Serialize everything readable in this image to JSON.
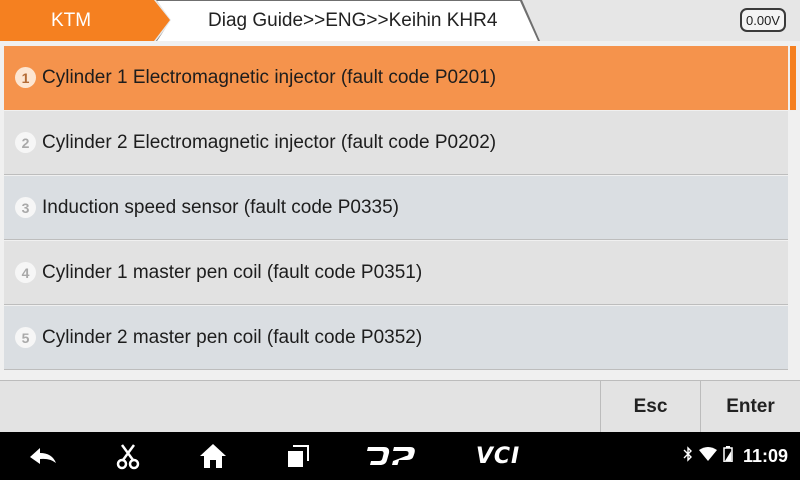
{
  "header": {
    "brand": "KTM",
    "breadcrumb": "Diag Guide>>ENG>>Keihin KHR4",
    "voltage": "0.00V"
  },
  "list": {
    "items": [
      {
        "number": "1",
        "label": "Cylinder 1 Electromagnetic injector (fault code P0201)",
        "selected": true
      },
      {
        "number": "2",
        "label": "Cylinder 2 Electromagnetic injector (fault code P0202)",
        "selected": false
      },
      {
        "number": "3",
        "label": "Induction speed sensor (fault code P0335)",
        "selected": false
      },
      {
        "number": "4",
        "label": "Cylinder 1 master pen coil (fault code P0351)",
        "selected": false
      },
      {
        "number": "5",
        "label": "Cylinder 2 master pen coil (fault code P0352)",
        "selected": false
      }
    ]
  },
  "buttons": {
    "esc_label": "Esc",
    "enter_label": "Enter"
  },
  "navbar": {
    "icons": [
      "back-icon",
      "scissors-icon",
      "home-icon",
      "recent-apps-icon",
      "dp-icon",
      "vci-icon"
    ],
    "vci_label": "VCI",
    "time": "11:09"
  },
  "colors": {
    "accent": "#f58020",
    "selected_row": "#f5934c"
  }
}
